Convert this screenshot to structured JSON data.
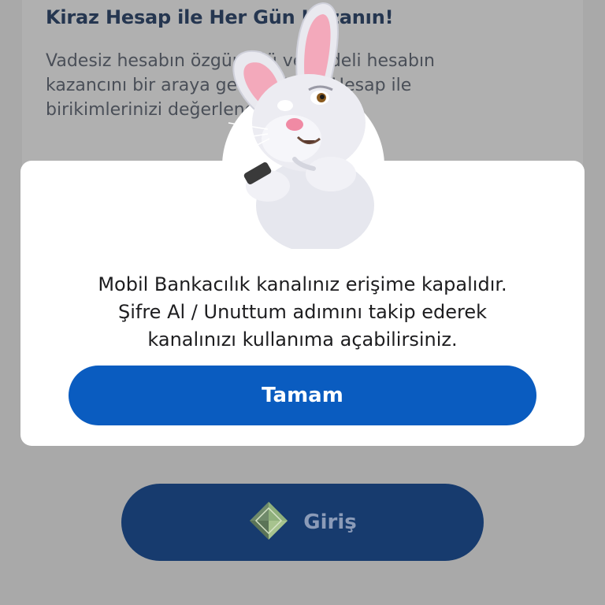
{
  "promo": {
    "title": "Kiraz Hesap ile Her Gün Kazanın!",
    "body": "Vadesiz hesabın özgürlüğü ve vadeli hesabın kazancını bir araya getiren Kiraz Hesap ile birikimlerinizi değerlendirin."
  },
  "modal": {
    "message_lines": [
      "Mobil Bankacılık kanalınız erişime kapalıdır.",
      "Şifre Al / Unuttum adımını takip ederek",
      "kanalınızı kullanıma açabilirsiniz."
    ],
    "ok_label": "Tamam",
    "mascot": "rabbit-mascot-icon"
  },
  "login": {
    "label": "Giriş",
    "icon": "diamond-logo-icon"
  },
  "colors": {
    "primary_button": "#0a5cc0",
    "login_button": "#173b6e",
    "overlay": "#a9a9a9"
  }
}
